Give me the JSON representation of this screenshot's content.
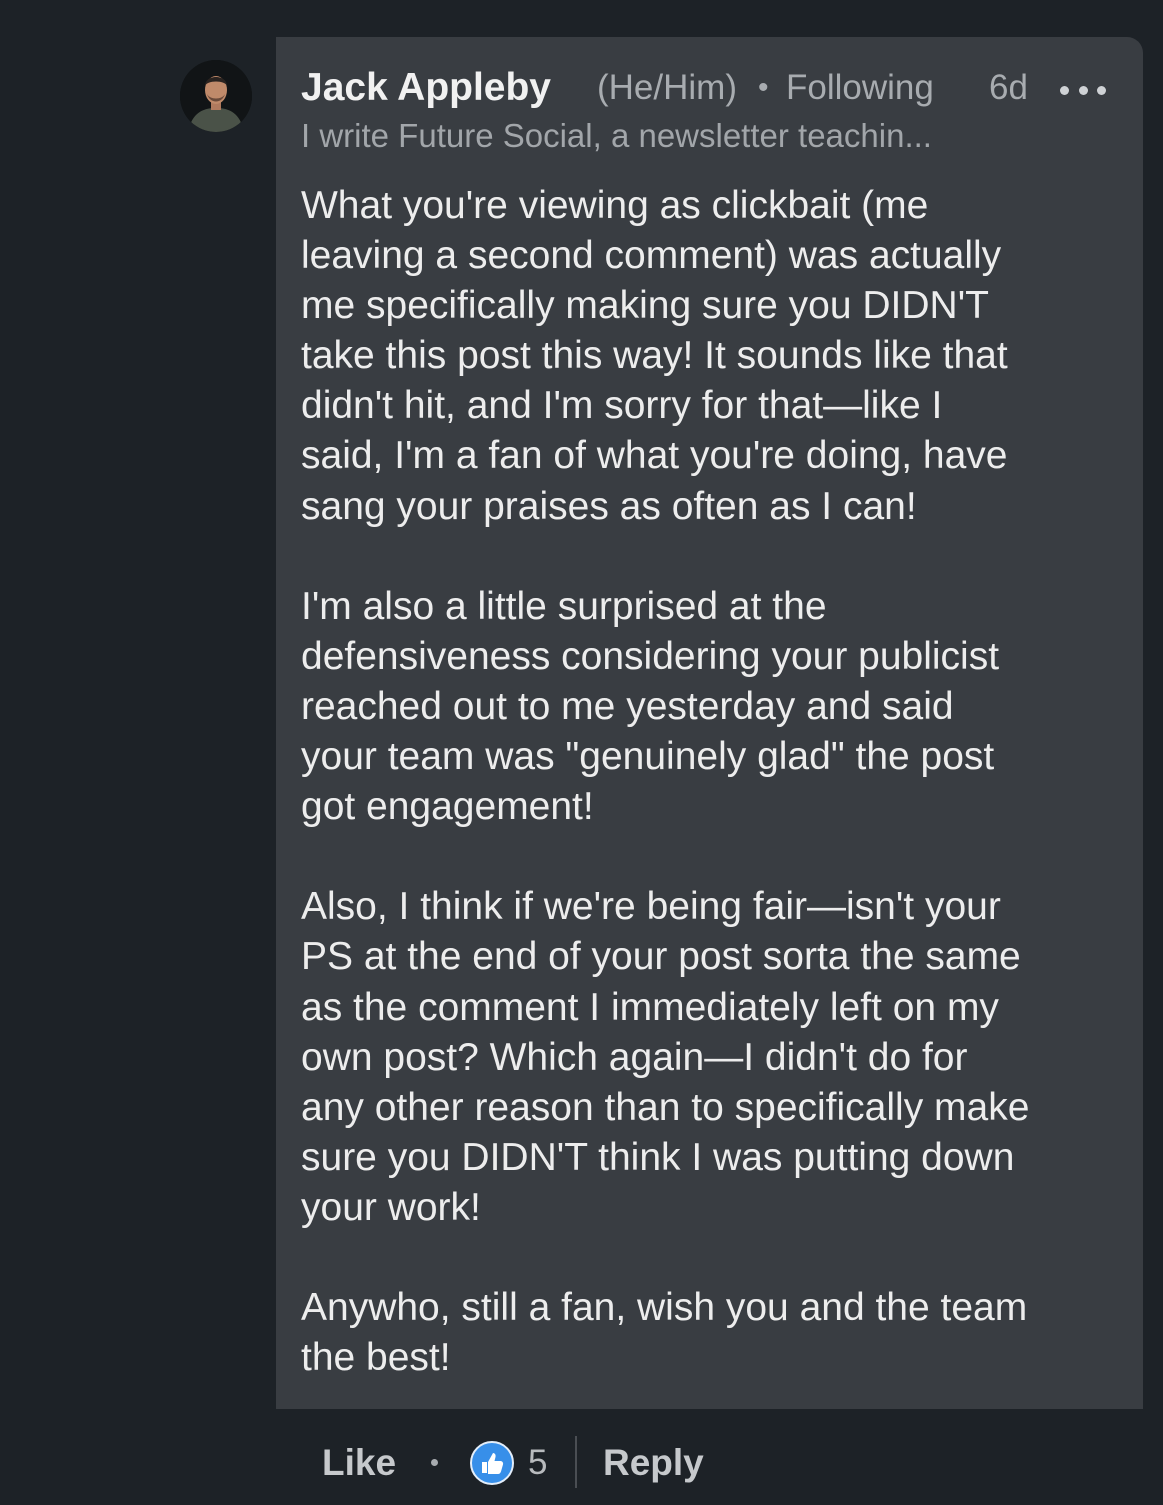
{
  "comment": {
    "author": {
      "name": "Jack Appleby",
      "pronouns": "(He/Him)",
      "separator": "•",
      "relationship": "Following",
      "headline": "I write Future Social, a newsletter teachin..."
    },
    "timestamp": "6d",
    "more_icon": "more-horizontal-icon",
    "body_lines": [
      "What you're viewing as clickbait (me",
      "leaving a second comment) was actually",
      "me specifically making sure you DIDN'T",
      "take this post this way! It sounds like that",
      "didn't hit, and I'm sorry for that—like I",
      "said, I'm a fan of what you're doing, have",
      "sang your praises as often as I can!",
      "",
      "I'm also a little surprised at the",
      "defensiveness considering your publicist",
      "reached out to me yesterday and said",
      "your team was \"genuinely glad\" the post",
      "got engagement!",
      "",
      "Also, I think if we're being fair—isn't your",
      "PS at the end of your post sorta the same",
      "as the comment I immediately left on my",
      "own post? Which again—I didn't do for",
      "any other reason than to specifically make",
      "sure you DIDN'T think I was putting down",
      "your work!",
      "",
      "Anywho, still a fan, wish you and the team",
      "the best!"
    ]
  },
  "actions": {
    "like_label": "Like",
    "separator": "•",
    "reaction_icon": "thumbs-up-icon",
    "reaction_count": "5",
    "reply_label": "Reply"
  },
  "colors": {
    "background": "#1d2227",
    "bubble": "#393d42",
    "reaction_blue": "#378fe9"
  }
}
